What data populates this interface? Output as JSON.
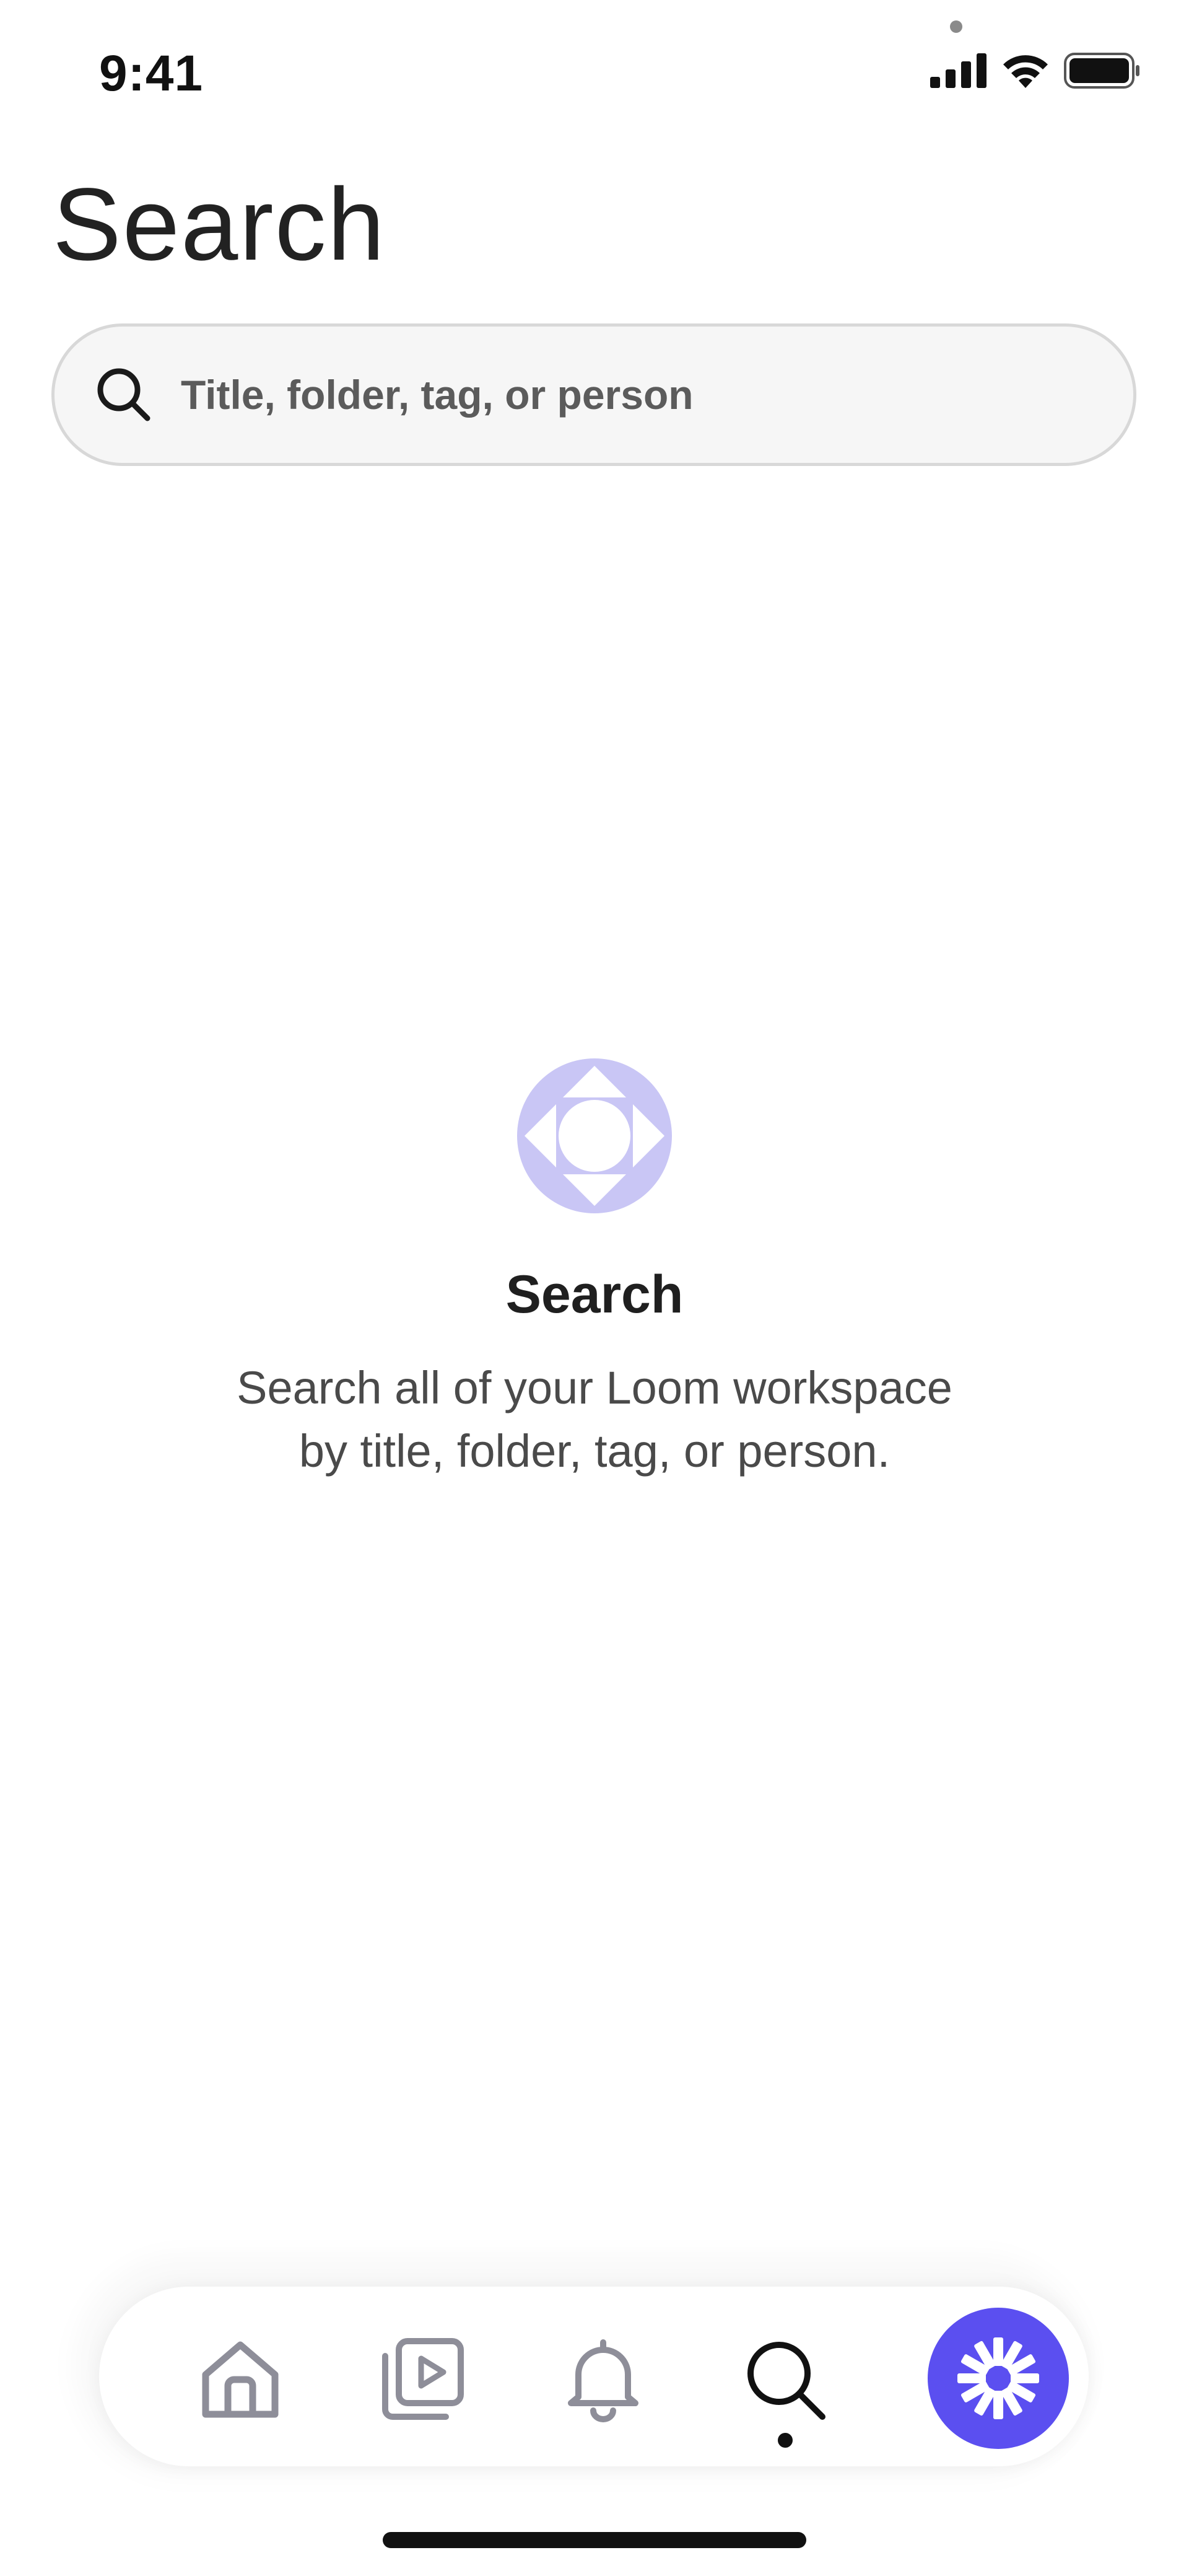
{
  "status_bar": {
    "time": "9:41"
  },
  "header": {
    "title": "Search"
  },
  "search": {
    "placeholder": "Title, folder, tag, or person",
    "value": ""
  },
  "empty_state": {
    "title": "Search",
    "description": "Search all of your Loom workspace by title, folder, tag, or person."
  },
  "tab_bar": {
    "tabs": [
      {
        "name": "home",
        "icon": "home-icon",
        "active": false
      },
      {
        "name": "library",
        "icon": "video-library-icon",
        "active": false
      },
      {
        "name": "notifications",
        "icon": "bell-icon",
        "active": false
      },
      {
        "name": "search",
        "icon": "search-icon",
        "active": true
      }
    ],
    "record_icon": "loom-logo-icon"
  },
  "colors": {
    "accent": "#5b4ff0",
    "empty_icon": "#c9c6f5",
    "inactive_icon": "#8e8e99",
    "active_icon": "#111111"
  }
}
